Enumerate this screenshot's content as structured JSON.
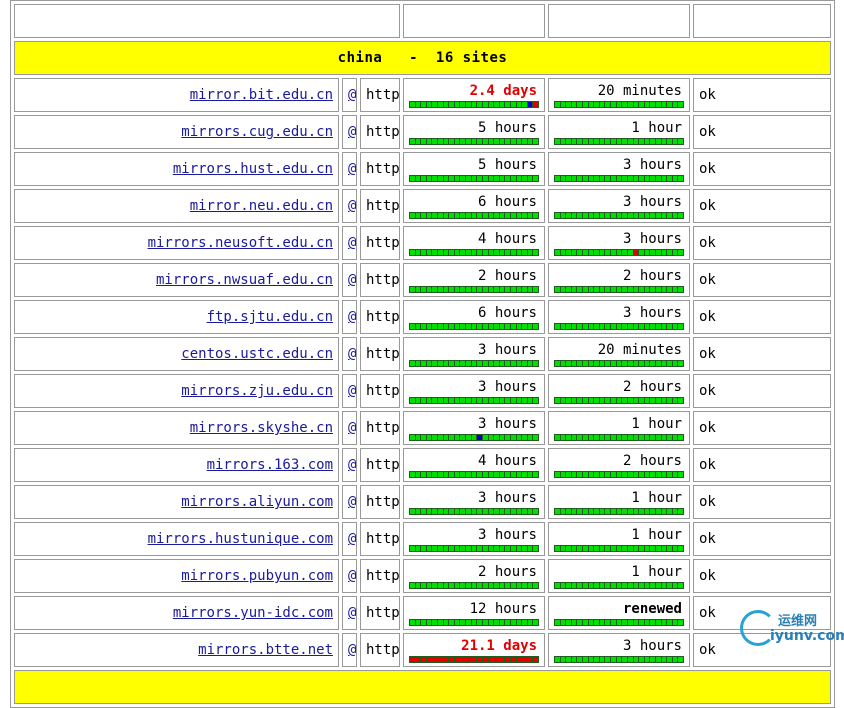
{
  "header": {
    "title": "china   -  16 sites"
  },
  "colors": {
    "header_bg": "#ffff00",
    "ok": "#00e000",
    "bad": "#e00000",
    "mark": "#0000c8",
    "link": "#1a1a9c"
  },
  "rows": [
    {
      "host": "mirror.bit.edu.cn",
      "at": "@",
      "proto": "http",
      "age1": "2.4 days",
      "age1_bad": true,
      "bar1": "gggggggggggggggggggggbr",
      "age2": "20 minutes",
      "bar2": "ggggggggggggggggggggggg",
      "status": "ok"
    },
    {
      "host": "mirrors.cug.edu.cn",
      "at": "@",
      "proto": "http",
      "age1": "5 hours",
      "bar1": "ggggggggggggggggggggggg",
      "age2": "1 hour",
      "bar2": "ggggggggggggggggggggggg",
      "status": "ok"
    },
    {
      "host": "mirrors.hust.edu.cn",
      "at": "@",
      "proto": "http",
      "age1": "5 hours",
      "bar1": "ggggggggggggggggggggggg",
      "age2": "3 hours",
      "bar2": "ggggggggggggggggggggggg",
      "status": "ok"
    },
    {
      "host": "mirror.neu.edu.cn",
      "at": "@",
      "proto": "http",
      "age1": "6 hours",
      "bar1": "ggggggggggggggggggggggg",
      "age2": "3 hours",
      "bar2": "ggggggggggggggggggggggg",
      "status": "ok"
    },
    {
      "host": "mirrors.neusoft.edu.cn",
      "at": "@",
      "proto": "http",
      "age1": "4 hours",
      "bar1": "ggggggggggggggggggggggg",
      "age2": "3 hours",
      "bar2": "ggggggggggggggrgggggggg",
      "status": "ok"
    },
    {
      "host": "mirrors.nwsuaf.edu.cn",
      "at": "@",
      "proto": "http",
      "age1": "2 hours",
      "bar1": "ggggggggggggggggggggggg",
      "age2": "2 hours",
      "bar2": "ggggggggggggggggggggggg",
      "status": "ok"
    },
    {
      "host": "ftp.sjtu.edu.cn",
      "at": "@",
      "proto": "http",
      "age1": "6 hours",
      "bar1": "ggggggggggggggggggggggg",
      "age2": "3 hours",
      "bar2": "ggggggggggggggggggggggg",
      "status": "ok"
    },
    {
      "host": "centos.ustc.edu.cn",
      "at": "@",
      "proto": "http",
      "age1": "3 hours",
      "bar1": "ggggggggggggggggggggggg",
      "age2": "20 minutes",
      "bar2": "ggggggggggggggggggggggg",
      "status": "ok"
    },
    {
      "host": "mirrors.zju.edu.cn",
      "at": "@",
      "proto": "http",
      "age1": "3 hours",
      "bar1": "ggggggggggggggggggggggg",
      "age2": "2 hours",
      "bar2": "ggggggggggggggggggggggg",
      "status": "ok"
    },
    {
      "host": "mirrors.skyshe.cn",
      "at": "@",
      "proto": "http",
      "age1": "3 hours",
      "bar1": "ggggggggggggbgggggggggg",
      "age2": "1 hour",
      "bar2": "ggggggggggggggggggggggg",
      "status": "ok"
    },
    {
      "host": "mirrors.163.com",
      "at": "@",
      "proto": "http",
      "age1": "4 hours",
      "bar1": "ggggggggggggggggggggggg",
      "age2": "2 hours",
      "bar2": "ggggggggggggggggggggggg",
      "status": "ok"
    },
    {
      "host": "mirrors.aliyun.com",
      "at": "@",
      "proto": "http",
      "age1": "3 hours",
      "bar1": "ggggggggggggggggggggggg",
      "age2": "1 hour",
      "bar2": "ggggggggggggggggggggggg",
      "status": "ok"
    },
    {
      "host": "mirrors.hustunique.com",
      "at": "@",
      "proto": "http",
      "age1": "3 hours",
      "bar1": "ggggggggggggggggggggggg",
      "age2": "1 hour",
      "bar2": "ggggggggggggggggggggggg",
      "status": "ok"
    },
    {
      "host": "mirrors.pubyun.com",
      "at": "@",
      "proto": "http",
      "age1": "2 hours",
      "bar1": "ggggggggggggggggggggggg",
      "age2": "1 hour",
      "bar2": "ggggggggggggggggggggggg",
      "status": "ok"
    },
    {
      "host": "mirrors.yun-idc.com",
      "at": "@",
      "proto": "http",
      "age1": "12 hours",
      "bar1": "ggggggggggggggggggggggg",
      "age2": "renewed",
      "age2_bold": true,
      "bar2": "ggggggggggggggggggggggg",
      "status": "ok"
    },
    {
      "host": "mirrors.btte.net",
      "at": "@",
      "proto": "http",
      "age1": "21.1 days",
      "age1_bad": true,
      "bar1": "rrrrrrrrrrrrrrrrrrrrrrr",
      "age2": "3 hours",
      "bar2": "ggggggggggggggggggggggg",
      "status": "ok"
    }
  ],
  "watermark": {
    "cn": "运维网",
    "en": "iyunv.com"
  }
}
